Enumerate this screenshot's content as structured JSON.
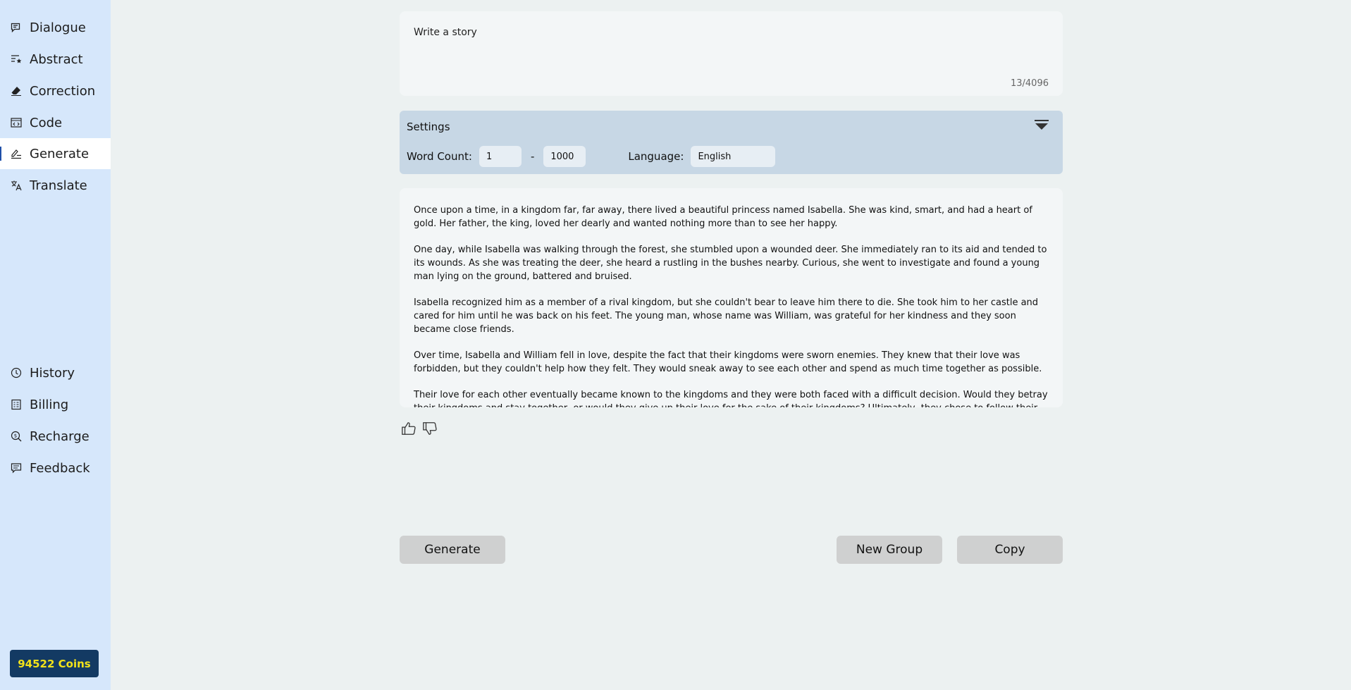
{
  "sidebar": {
    "top_items": [
      {
        "label": "Dialogue",
        "icon": "chat-icon"
      },
      {
        "label": "Abstract",
        "icon": "list-star-icon"
      },
      {
        "label": "Correction",
        "icon": "eraser-icon"
      },
      {
        "label": "Code",
        "icon": "code-icon"
      },
      {
        "label": "Generate",
        "icon": "pen-lines-icon"
      },
      {
        "label": "Translate",
        "icon": "translate-icon"
      }
    ],
    "active_item": "Generate",
    "bottom_items": [
      {
        "label": "History",
        "icon": "clock-icon"
      },
      {
        "label": "Billing",
        "icon": "receipt-icon"
      },
      {
        "label": "Recharge",
        "icon": "coin-search-icon"
      },
      {
        "label": "Feedback",
        "icon": "feedback-icon"
      }
    ],
    "coins_label": "94522 Coins"
  },
  "prompt": {
    "text": "Write a story",
    "char_count": "13/4096"
  },
  "settings": {
    "title": "Settings",
    "word_count_label": "Word Count:",
    "word_count_min": "1",
    "word_count_max": "1000",
    "separator": "-",
    "language_label": "Language:",
    "language_value": "English"
  },
  "output": {
    "paragraphs": [
      "Once upon a time, in a kingdom far, far away, there lived a beautiful princess named Isabella. She was kind, smart, and had a heart of gold. Her father, the king, loved her dearly and wanted nothing more than to see her happy.",
      "One day, while Isabella was walking through the forest, she stumbled upon a wounded deer. She immediately ran to its aid and tended to its wounds. As she was treating the deer, she heard a rustling in the bushes nearby. Curious, she went to investigate and found a young man lying on the ground, battered and bruised.",
      "Isabella recognized him as a member of a rival kingdom, but she couldn't bear to leave him there to die. She took him to her castle and cared for him until he was back on his feet. The young man, whose name was William, was grateful for her kindness and they soon became close friends.",
      "Over time, Isabella and William fell in love, despite the fact that their kingdoms were sworn enemies. They knew that their love was forbidden, but they couldn't help how they felt. They would sneak away to see each other and spend as much time together as possible.",
      "Their love for each other eventually became known to the kingdoms and they were both faced with a difficult decision. Would they betray their kingdoms and stay together, or would they give up their love for the sake of their kingdoms? Ultimately, they chose to follow their hearts and be with each other."
    ]
  },
  "actions": {
    "generate_label": "Generate",
    "new_group_label": "New Group",
    "copy_label": "Copy"
  },
  "colors": {
    "sidebar_bg": "#d6e7fb",
    "page_bg": "#ecf1f1",
    "settings_bg": "#c7d7e5",
    "coins_bg": "#133a63",
    "coins_text": "#f2e21a",
    "button_bg": "#cfd0d0"
  }
}
